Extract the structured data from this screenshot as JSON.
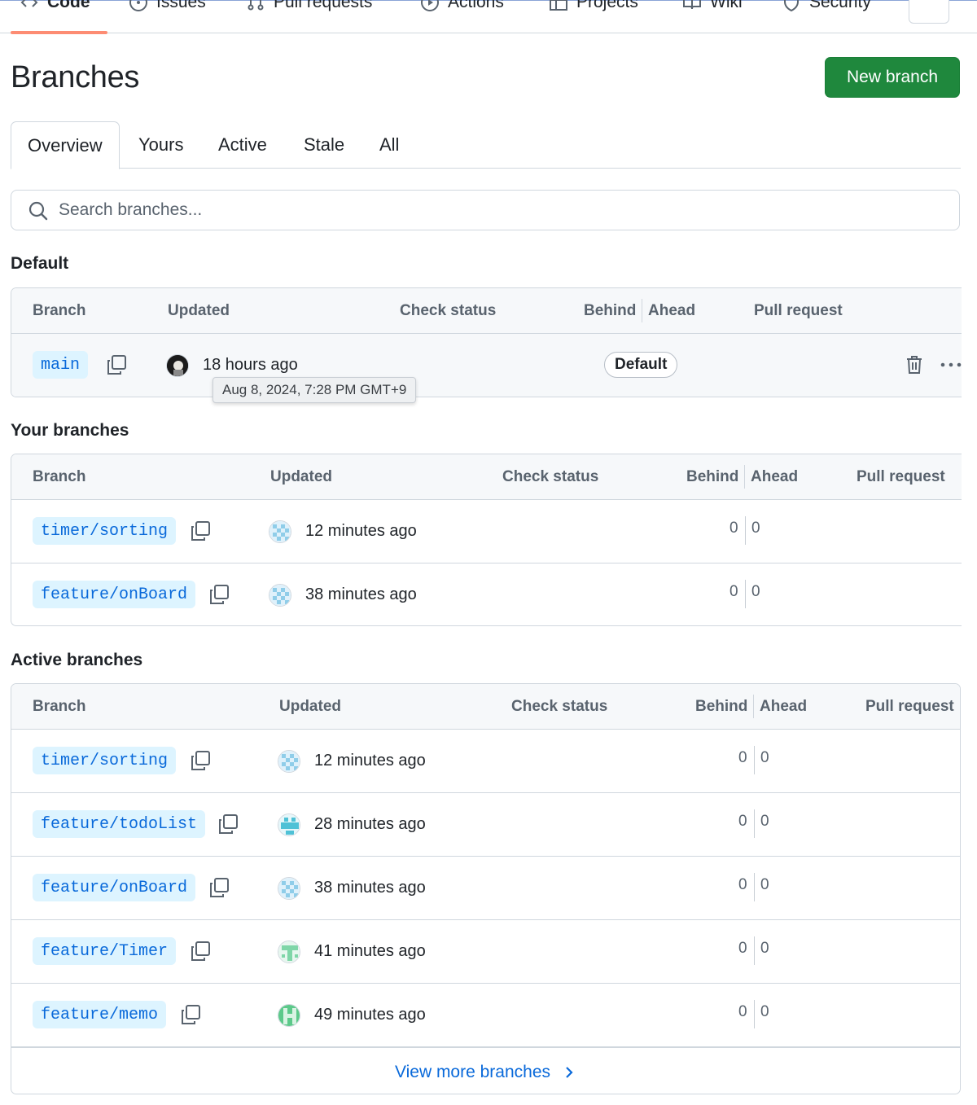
{
  "repo_nav": {
    "items": [
      {
        "label": "Code",
        "icon": "code-icon"
      },
      {
        "label": "Issues",
        "icon": "issue-opened-icon"
      },
      {
        "label": "Pull requests",
        "icon": "git-pull-request-icon"
      },
      {
        "label": "Actions",
        "icon": "play-icon"
      },
      {
        "label": "Projects",
        "icon": "table-icon"
      },
      {
        "label": "Wiki",
        "icon": "book-icon"
      },
      {
        "label": "Security",
        "icon": "shield-icon"
      }
    ],
    "active_color": "#fd8c73"
  },
  "page": {
    "title": "Branches",
    "new_branch_label": "New branch"
  },
  "tabs": [
    "Overview",
    "Yours",
    "Active",
    "Stale",
    "All"
  ],
  "search": {
    "placeholder": "Search branches..."
  },
  "columns": {
    "branch": "Branch",
    "updated": "Updated",
    "check_status": "Check status",
    "behind": "Behind",
    "ahead": "Ahead",
    "pull_request": "Pull request"
  },
  "default_section": {
    "title": "Default",
    "rows": [
      {
        "branch": "main",
        "updated": "18 hours ago",
        "badge": "Default"
      }
    ],
    "tooltip": "Aug 8, 2024, 7:28 PM GMT+9"
  },
  "your_section": {
    "title": "Your branches",
    "rows": [
      {
        "branch": "timer/sorting",
        "updated": "12 minutes ago",
        "behind": "0",
        "ahead": "0"
      },
      {
        "branch": "feature/onBoard",
        "updated": "38 minutes ago",
        "behind": "0",
        "ahead": "0"
      }
    ]
  },
  "active_section": {
    "title": "Active branches",
    "rows": [
      {
        "branch": "timer/sorting",
        "updated": "12 minutes ago",
        "behind": "0",
        "ahead": "0"
      },
      {
        "branch": "feature/todoList",
        "updated": "28 minutes ago",
        "behind": "0",
        "ahead": "0"
      },
      {
        "branch": "feature/onBoard",
        "updated": "38 minutes ago",
        "behind": "0",
        "ahead": "0"
      },
      {
        "branch": "feature/Timer",
        "updated": "41 minutes ago",
        "behind": "0",
        "ahead": "0"
      },
      {
        "branch": "feature/memo",
        "updated": "49 minutes ago",
        "behind": "0",
        "ahead": "0"
      }
    ],
    "view_more": "View more branches"
  },
  "colors": {
    "primary_button": "#1f883d",
    "link": "#0969da",
    "branch_chip_bg": "#ddf4ff",
    "border": "#d0d7de"
  }
}
